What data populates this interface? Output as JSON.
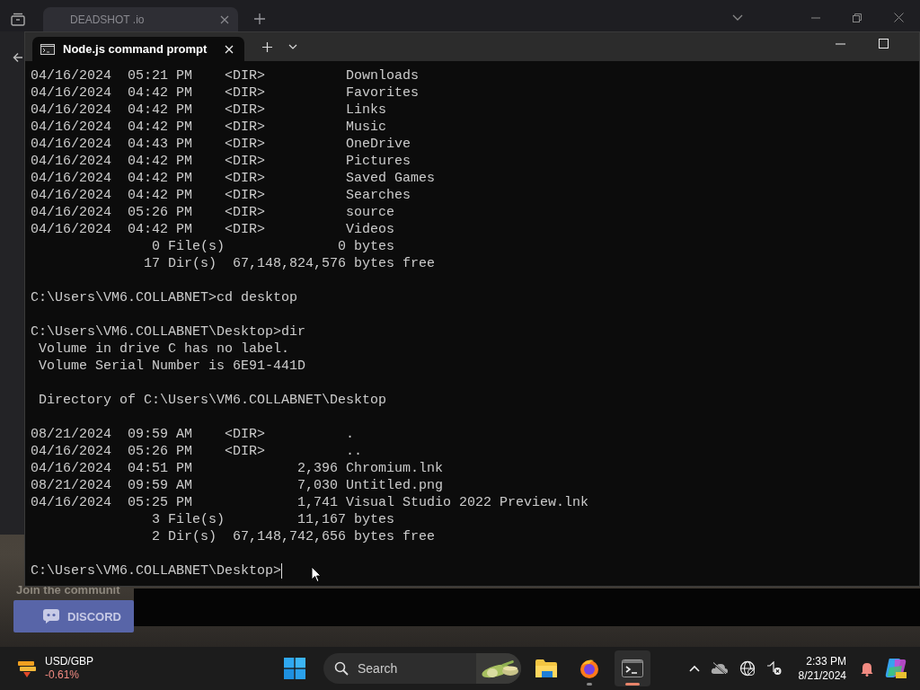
{
  "browser": {
    "tab": {
      "title": "DEADSHOT .io"
    },
    "page": {
      "community_heading": "Join the communit",
      "discord_button": "DISCORD"
    }
  },
  "terminal": {
    "tab": {
      "title": "Node.js command prompt",
      "selected": true
    },
    "blocks": [
      [
        "04/16/2024  05:21 PM    <DIR>          Downloads",
        "04/16/2024  04:42 PM    <DIR>          Favorites",
        "04/16/2024  04:42 PM    <DIR>          Links",
        "04/16/2024  04:42 PM    <DIR>          Music",
        "04/16/2024  04:43 PM    <DIR>          OneDrive",
        "04/16/2024  04:42 PM    <DIR>          Pictures",
        "04/16/2024  04:42 PM    <DIR>          Saved Games",
        "04/16/2024  04:42 PM    <DIR>          Searches",
        "04/16/2024  05:26 PM    <DIR>          source",
        "04/16/2024  04:42 PM    <DIR>          Videos",
        "               0 File(s)              0 bytes",
        "              17 Dir(s)  67,148,824,576 bytes free"
      ],
      [
        "C:\\Users\\VM6.COLLABNET>cd desktop"
      ],
      [
        "C:\\Users\\VM6.COLLABNET\\Desktop>dir",
        " Volume in drive C has no label.",
        " Volume Serial Number is 6E91-441D"
      ],
      [
        " Directory of C:\\Users\\VM6.COLLABNET\\Desktop"
      ],
      [
        "08/21/2024  09:59 AM    <DIR>          .",
        "04/16/2024  05:26 PM    <DIR>          ..",
        "04/16/2024  04:51 PM             2,396 Chromium.lnk",
        "08/21/2024  09:59 AM             7,030 Untitled.png",
        "04/16/2024  05:25 PM             1,741 Visual Studio 2022 Preview.lnk",
        "               3 File(s)         11,167 bytes",
        "               2 Dir(s)  67,148,742,656 bytes free"
      ]
    ],
    "prompt": "C:\\Users\\VM6.COLLABNET\\Desktop>",
    "cursor": true
  },
  "taskbar": {
    "widget": {
      "label": "USD/GBP",
      "change": "-0.61%"
    },
    "search": {
      "placeholder": "Search"
    },
    "apps": [
      {
        "kind": "explorer",
        "running": false,
        "selected": false
      },
      {
        "kind": "firefox",
        "running": true,
        "selected": false
      },
      {
        "kind": "terminal",
        "running": true,
        "selected": true
      }
    ],
    "clock": {
      "time": "2:33 PM",
      "date": "8/21/2024"
    }
  }
}
